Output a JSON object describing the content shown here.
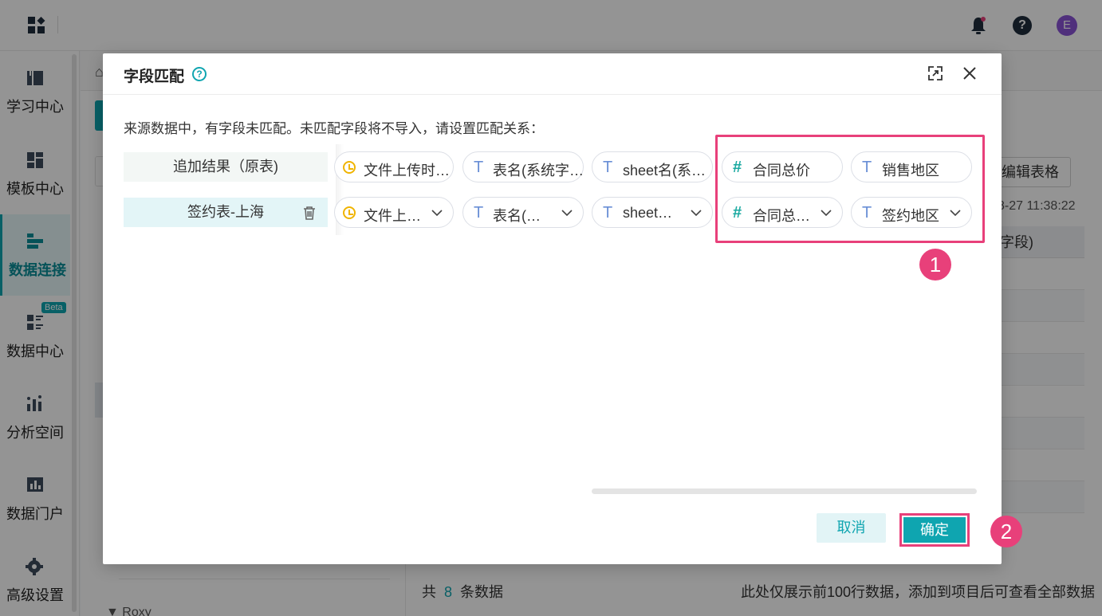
{
  "app": {
    "sidebar": [
      {
        "label": "学习中心",
        "icon": "book-icon"
      },
      {
        "label": "模板中心",
        "icon": "template-icon"
      },
      {
        "label": "数据连接",
        "icon": "data-connection-icon",
        "active": true
      },
      {
        "label": "数据中心",
        "icon": "data-center-icon",
        "badge": "Beta"
      },
      {
        "label": "分析空间",
        "icon": "analysis-icon"
      },
      {
        "label": "数据门户",
        "icon": "portal-icon"
      },
      {
        "label": "高级设置",
        "icon": "gear-icon"
      }
    ],
    "avatar_letter": "E",
    "help_glyph": "?",
    "background": {
      "edit_table_button": "编辑表格",
      "date_text": "8-27 11:38:22",
      "column_header": "字段)",
      "footer_prefix": "共",
      "footer_count": "8",
      "footer_suffix": "条数据",
      "footer_note": "此处仅展示前100行数据，添加到项目后可查看全部数据",
      "tree_item": "▼  Roxy"
    }
  },
  "dialog": {
    "title": "字段匹配",
    "help_glyph": "?",
    "description": "来源数据中，有字段未匹配。未匹配字段将不导入，请设置匹配关系：",
    "rows": [
      {
        "source_label": "追加结果（原表)",
        "fields": [
          {
            "type": "date",
            "label": "文件上传时…"
          },
          {
            "type": "text",
            "label": "表名(系统字…"
          },
          {
            "type": "text",
            "label": "sheet名(系…"
          },
          {
            "type": "number",
            "label": "合同总价"
          },
          {
            "type": "text",
            "label": "销售地区"
          }
        ]
      },
      {
        "source_label": "签约表-上海",
        "fields": [
          {
            "type": "date",
            "label": "文件上…",
            "dropdown": true
          },
          {
            "type": "text",
            "label": "表名(…",
            "dropdown": true
          },
          {
            "type": "text",
            "label": "sheet…",
            "dropdown": true
          },
          {
            "type": "number",
            "label": "合同总…",
            "dropdown": true
          },
          {
            "type": "text",
            "label": "签约地区",
            "dropdown": true
          }
        ]
      }
    ],
    "type_glyphs": {
      "text": "T",
      "number": "#"
    },
    "cancel_label": "取消",
    "ok_label": "确定",
    "annotations": [
      "1",
      "2"
    ],
    "highlight_color": "#e8407a",
    "accent_color": "#0fa5b0"
  }
}
